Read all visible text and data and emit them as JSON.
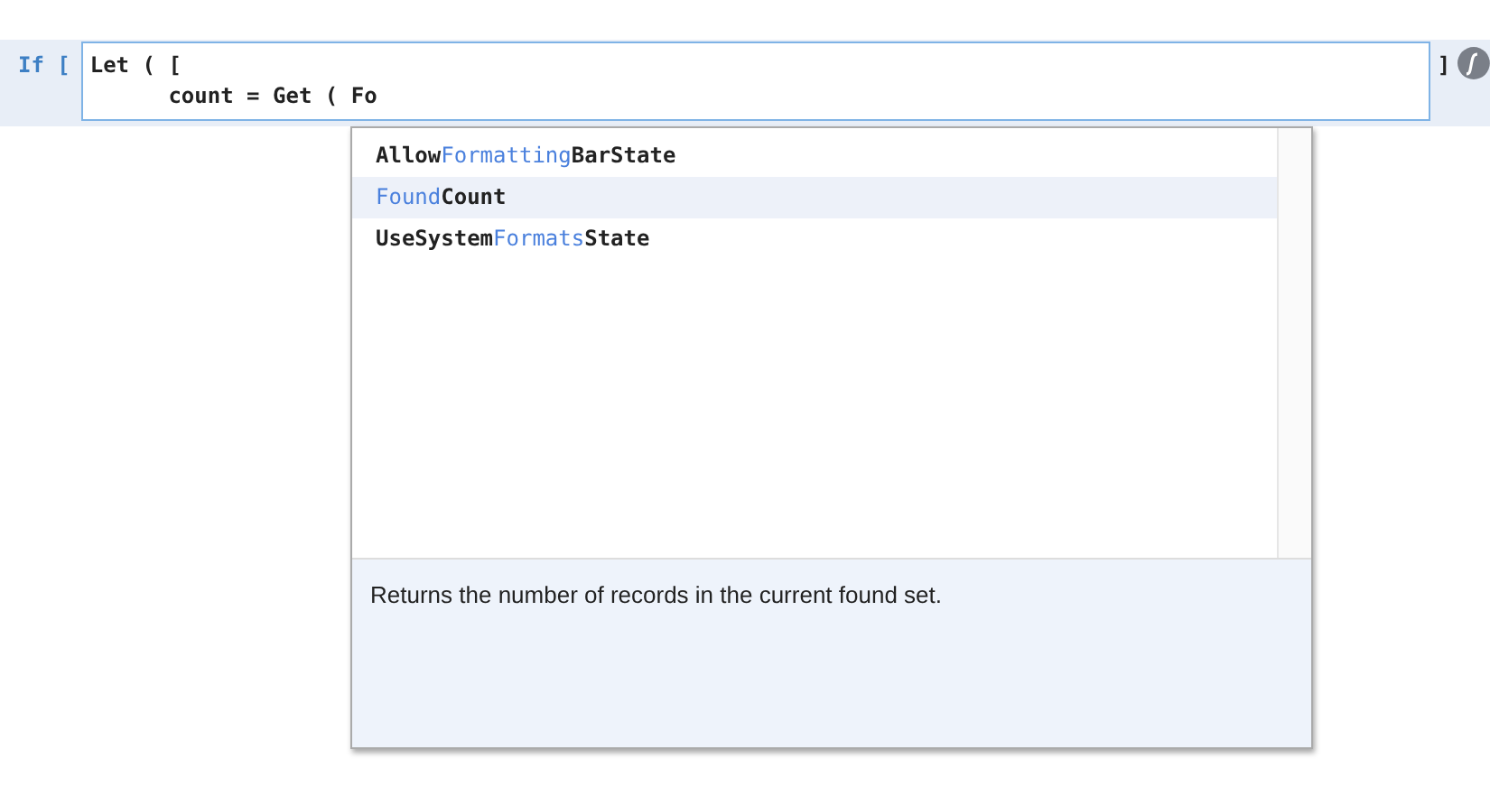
{
  "step": {
    "keyword": "If [",
    "closing": "]",
    "code_lines": [
      "Let ( [",
      "      count = Get ( Fo"
    ]
  },
  "autocomplete": {
    "items": [
      {
        "selected": false,
        "segments": [
          {
            "text": "Allow",
            "kind": "plain"
          },
          {
            "text": "Formatting",
            "kind": "match"
          },
          {
            "text": "BarState",
            "kind": "plain"
          }
        ]
      },
      {
        "selected": true,
        "segments": [
          {
            "text": "Found",
            "kind": "match"
          },
          {
            "text": "Count",
            "kind": "plain"
          }
        ]
      },
      {
        "selected": false,
        "segments": [
          {
            "text": "UseSystem",
            "kind": "plain"
          },
          {
            "text": "Formats",
            "kind": "match"
          },
          {
            "text": "State",
            "kind": "plain"
          }
        ]
      }
    ],
    "description": "Returns the number of records in the current found set."
  }
}
